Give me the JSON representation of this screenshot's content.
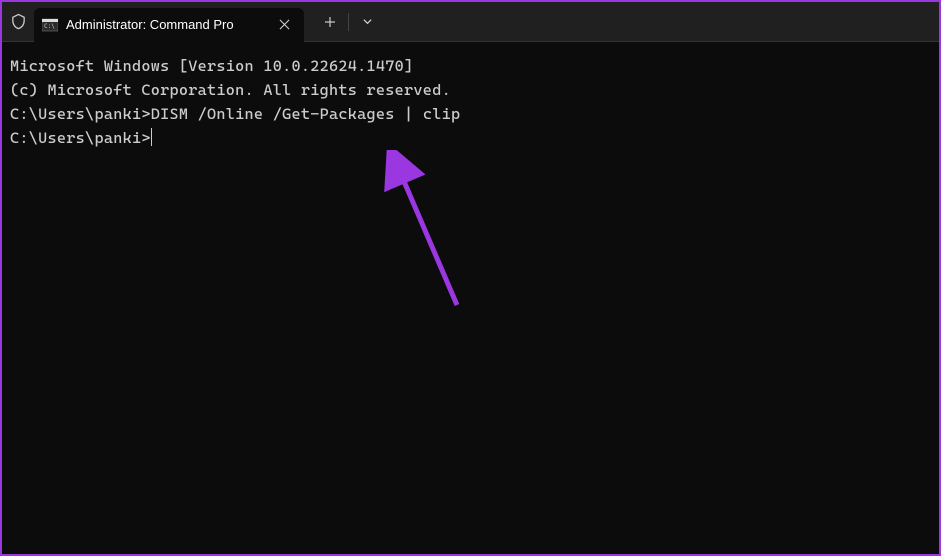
{
  "tab": {
    "title": "Administrator: Command Pro"
  },
  "terminal": {
    "line1": "Microsoft Windows [Version 10.0.22624.1470]",
    "line2": "(c) Microsoft Corporation. All rights reserved.",
    "blank1": "",
    "prompt1": "C:\\Users\\panki>",
    "command1": "DISM /Online /Get-Packages | clip",
    "blank2": "",
    "prompt2": "C:\\Users\\panki>"
  },
  "annotation": {
    "color": "#9b37e0"
  }
}
